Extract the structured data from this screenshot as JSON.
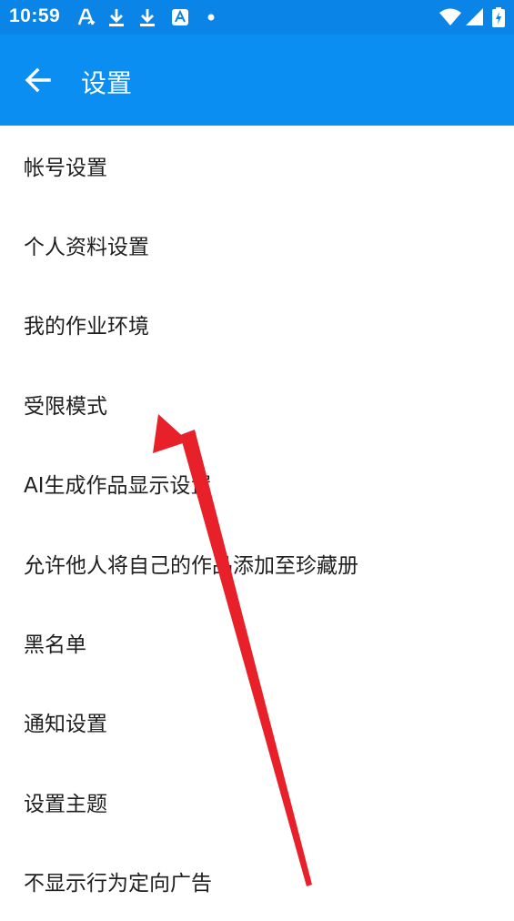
{
  "status_bar": {
    "time": "10:59",
    "icons": [
      "text-notification-icon",
      "download-icon",
      "download-icon",
      "app-notification-icon",
      "dot-icon",
      "wifi-icon",
      "signal-icon",
      "battery-charging-icon"
    ]
  },
  "app_bar": {
    "title": "设置",
    "back_icon": "arrow-left-icon",
    "color": "#0a8ef2"
  },
  "settings": {
    "items": [
      {
        "label": "帐号设置"
      },
      {
        "label": "个人资料设置"
      },
      {
        "label": "我的作业环境"
      },
      {
        "label": "受限模式"
      },
      {
        "label": "AI生成作品显示设置"
      },
      {
        "label": "允许他人将自己的作品添加至珍藏册"
      },
      {
        "label": "黑名单"
      },
      {
        "label": "通知设置"
      },
      {
        "label": "设置主题"
      },
      {
        "label": "不显示行为定向广告"
      }
    ]
  },
  "annotation": {
    "type": "arrow",
    "color": "#e8202a",
    "points_to": "受限模式"
  }
}
